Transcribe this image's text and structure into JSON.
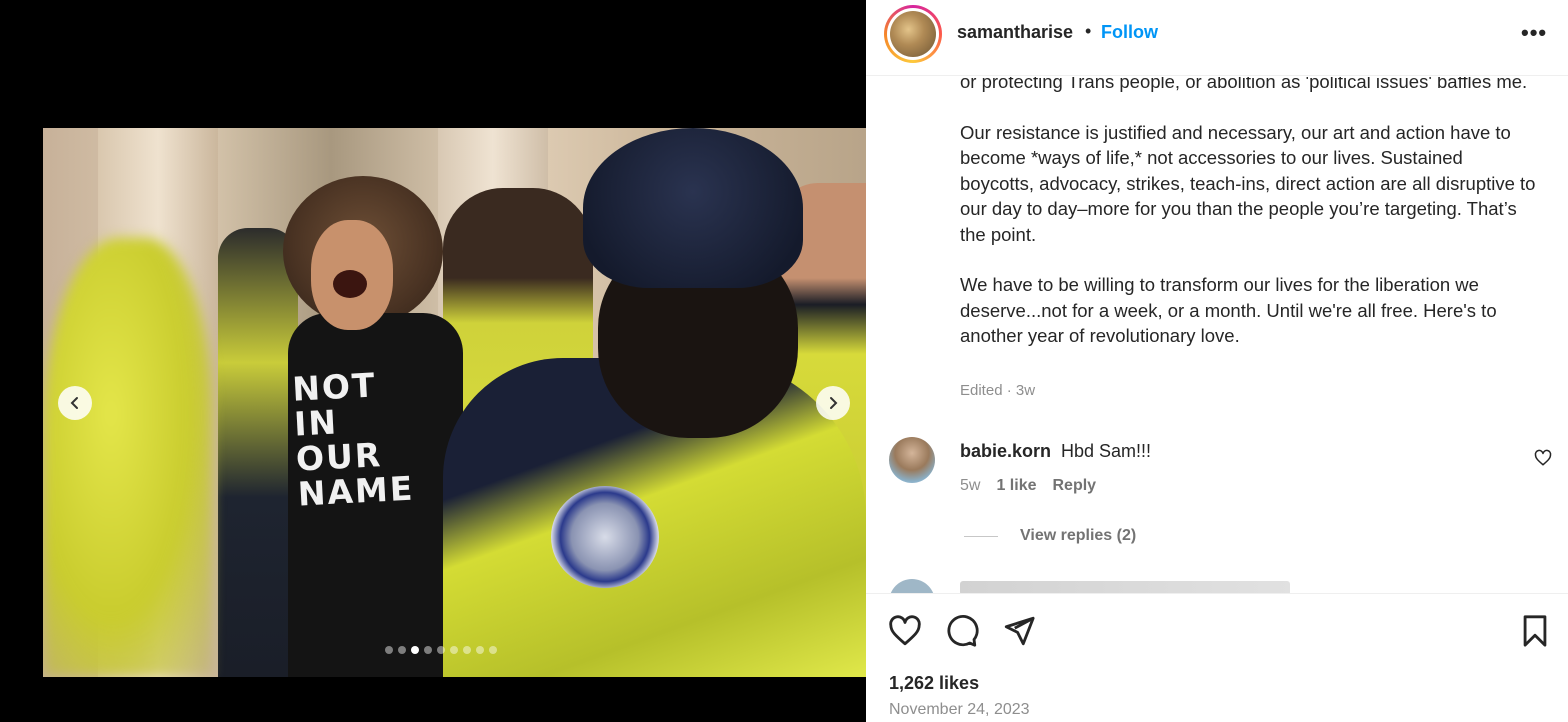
{
  "post": {
    "username": "samantharise",
    "separator": "•",
    "follow_label": "Follow",
    "more_label": "•••",
    "caption": [
      "or protecting Trans people, or abolition as 'political issues' baffles me.",
      "Our resistance is justified and necessary, our art and action have to become *ways of life,* not accessories to our lives. Sustained boycotts, advocacy, strikes, teach-ins, direct action are all disruptive to our day to day–more for you than the people you’re targeting. That’s the point.",
      "We have to be willing to transform our lives for the liberation we deserve...not for a week, or a month. Until we're all free. Here's to another year of revolutionary love."
    ],
    "edited": "Edited · 3w",
    "likes": "1,262 likes",
    "date": "November 24, 2023"
  },
  "media": {
    "shirt_text": [
      "NOT IN",
      "OUR",
      "NAME"
    ],
    "carousel_total": 9,
    "carousel_active": 3
  },
  "comments": [
    {
      "username": "babie.korn",
      "text": "Hbd Sam!!!",
      "age": "5w",
      "likes": "1 like",
      "reply_label": "Reply",
      "view_replies": "View replies (2)"
    }
  ],
  "icons": {
    "prev": "chevron-left-icon",
    "next": "chevron-right-icon",
    "like": "heart-icon",
    "comment": "comment-icon",
    "share": "share-icon",
    "save": "bookmark-icon"
  },
  "colors": {
    "accent": "#0095f6",
    "text": "#262626",
    "muted": "#8e8e8e"
  }
}
